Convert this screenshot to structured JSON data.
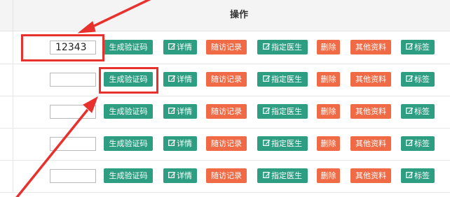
{
  "header": {
    "title": "操作"
  },
  "actions": {
    "generate_code": "生成验证码",
    "details": "详情",
    "follow_up": "随访记录",
    "assign_doctor": "指定医生",
    "delete": "删除",
    "other_info": "其他资料",
    "tag": "标签"
  },
  "rows": [
    {
      "code": "12343"
    },
    {
      "code": ""
    },
    {
      "code": ""
    },
    {
      "code": ""
    },
    {
      "code": ""
    }
  ],
  "colors": {
    "action_green": "#2e9e82",
    "action_orange": "#ef6a45",
    "annotation_red": "#e8312d"
  },
  "icons": {
    "edit": "edit-square-icon"
  }
}
